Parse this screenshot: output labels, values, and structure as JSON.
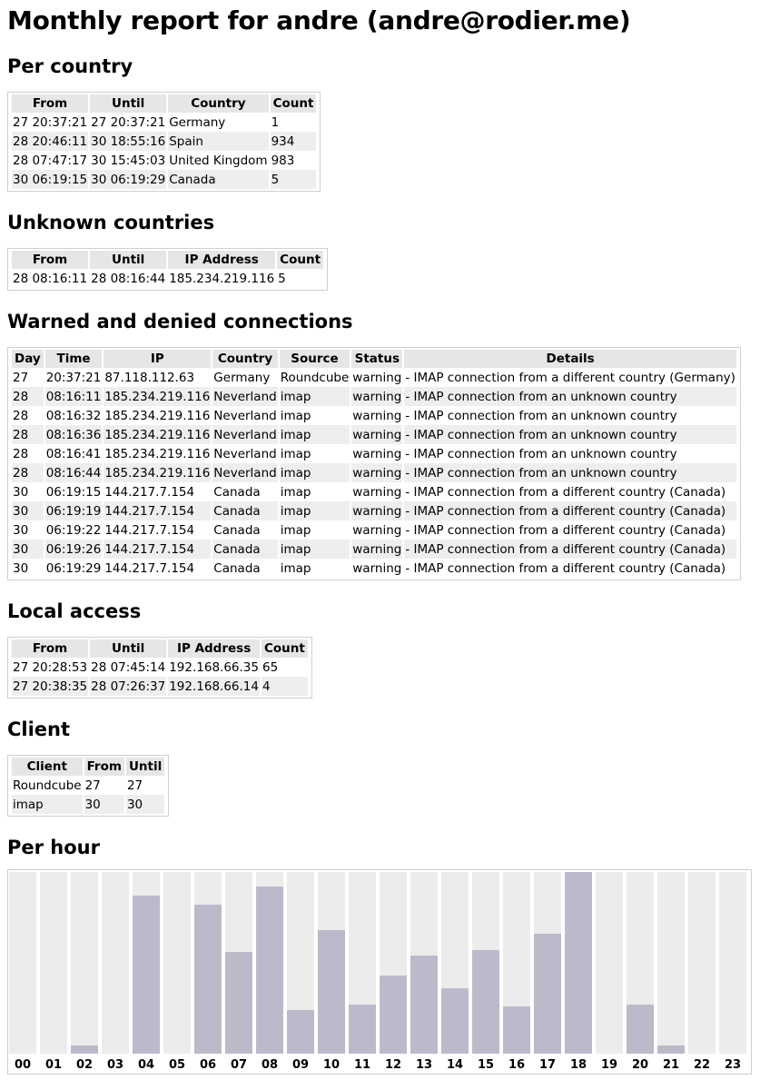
{
  "title": "Monthly report for andre (andre@rodier.me)",
  "per_country": {
    "heading": "Per country",
    "columns": [
      "From",
      "Until",
      "Country",
      "Count"
    ],
    "rows": [
      [
        "27 20:37:21",
        "27 20:37:21",
        "Germany",
        "1"
      ],
      [
        "28 20:46:11",
        "30 18:55:16",
        "Spain",
        "934"
      ],
      [
        "28 07:47:17",
        "30 15:45:03",
        "United Kingdom",
        "983"
      ],
      [
        "30 06:19:15",
        "30 06:19:29",
        "Canada",
        "5"
      ]
    ]
  },
  "unknown_countries": {
    "heading": "Unknown countries",
    "columns": [
      "From",
      "Until",
      "IP Address",
      "Count"
    ],
    "rows": [
      [
        "28 08:16:11",
        "28 08:16:44",
        "185.234.219.116",
        "5"
      ]
    ]
  },
  "warned": {
    "heading": "Warned and denied connections",
    "columns": [
      "Day",
      "Time",
      "IP",
      "Country",
      "Source",
      "Status",
      "Details"
    ],
    "rows": [
      [
        "27",
        "20:37:21",
        "87.118.112.63",
        "Germany",
        "Roundcube",
        "warning",
        "- IMAP connection from a different country (Germany)"
      ],
      [
        "28",
        "08:16:11",
        "185.234.219.116",
        "Neverland",
        "imap",
        "warning",
        "- IMAP connection from an unknown country"
      ],
      [
        "28",
        "08:16:32",
        "185.234.219.116",
        "Neverland",
        "imap",
        "warning",
        "- IMAP connection from an unknown country"
      ],
      [
        "28",
        "08:16:36",
        "185.234.219.116",
        "Neverland",
        "imap",
        "warning",
        "- IMAP connection from an unknown country"
      ],
      [
        "28",
        "08:16:41",
        "185.234.219.116",
        "Neverland",
        "imap",
        "warning",
        "- IMAP connection from an unknown country"
      ],
      [
        "28",
        "08:16:44",
        "185.234.219.116",
        "Neverland",
        "imap",
        "warning",
        "- IMAP connection from an unknown country"
      ],
      [
        "30",
        "06:19:15",
        "144.217.7.154",
        "Canada",
        "imap",
        "warning",
        "- IMAP connection from a different country (Canada)"
      ],
      [
        "30",
        "06:19:19",
        "144.217.7.154",
        "Canada",
        "imap",
        "warning",
        "- IMAP connection from a different country (Canada)"
      ],
      [
        "30",
        "06:19:22",
        "144.217.7.154",
        "Canada",
        "imap",
        "warning",
        "- IMAP connection from a different country (Canada)"
      ],
      [
        "30",
        "06:19:26",
        "144.217.7.154",
        "Canada",
        "imap",
        "warning",
        "- IMAP connection from a different country (Canada)"
      ],
      [
        "30",
        "06:19:29",
        "144.217.7.154",
        "Canada",
        "imap",
        "warning",
        "- IMAP connection from a different country (Canada)"
      ]
    ]
  },
  "local_access": {
    "heading": "Local access",
    "columns": [
      "From",
      "Until",
      "IP Address",
      "Count"
    ],
    "rows": [
      [
        "27 20:28:53",
        "28 07:45:14",
        "192.168.66.35",
        "65"
      ],
      [
        "27 20:38:35",
        "28 07:26:37",
        "192.168.66.14",
        "4"
      ]
    ]
  },
  "client": {
    "heading": "Client",
    "columns": [
      "Client",
      "From",
      "Until"
    ],
    "rows": [
      [
        "Roundcube",
        "27",
        "27"
      ],
      [
        "imap",
        "30",
        "30"
      ]
    ]
  },
  "per_hour": {
    "heading": "Per hour"
  },
  "chart_data": {
    "type": "bar",
    "categories": [
      "00",
      "01",
      "02",
      "03",
      "04",
      "05",
      "06",
      "07",
      "08",
      "09",
      "10",
      "11",
      "12",
      "13",
      "14",
      "15",
      "16",
      "17",
      "18",
      "19",
      "20",
      "21",
      "22",
      "23"
    ],
    "values": [
      0,
      0,
      4.5,
      0,
      87,
      0,
      82,
      56,
      92,
      24,
      68,
      27,
      43,
      54,
      36,
      57,
      26,
      66,
      100,
      0,
      27,
      4.5,
      0,
      0
    ],
    "ylim": [
      0,
      100
    ],
    "colors": {
      "bar": "#babaca",
      "background": "#ececec"
    }
  }
}
